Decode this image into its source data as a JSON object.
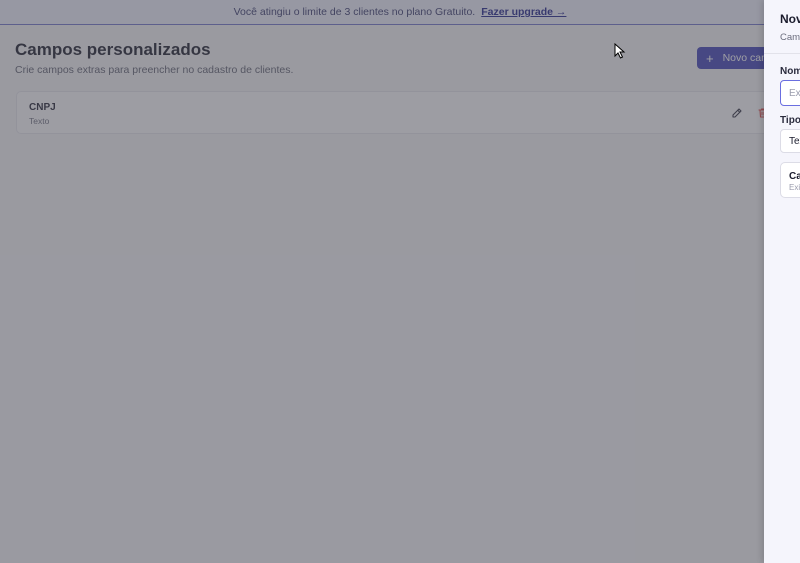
{
  "banner": {
    "message": "Você atingiu o limite de 3 clientes no plano Gratuito.",
    "upgrade_link": "Fazer upgrade →"
  },
  "page": {
    "title": "Campos personalizados",
    "subtitle": "Crie campos extras para preencher no cadastro de clientes.",
    "new_button_label": "Novo cam"
  },
  "fields": [
    {
      "name": "CNPJ",
      "type": "Texto"
    }
  ],
  "drawer": {
    "title": "Nov",
    "subtitle": "Camp",
    "name_label": "Nom",
    "name_placeholder": "Ex",
    "type_label": "Tipo",
    "type_value": "Tex",
    "checkbox_title": "Ca",
    "checkbox_desc": "Exi"
  },
  "colors": {
    "accent": "#3c3fb5",
    "danger": "#e04545",
    "banner_bg": "#eef0fc"
  }
}
